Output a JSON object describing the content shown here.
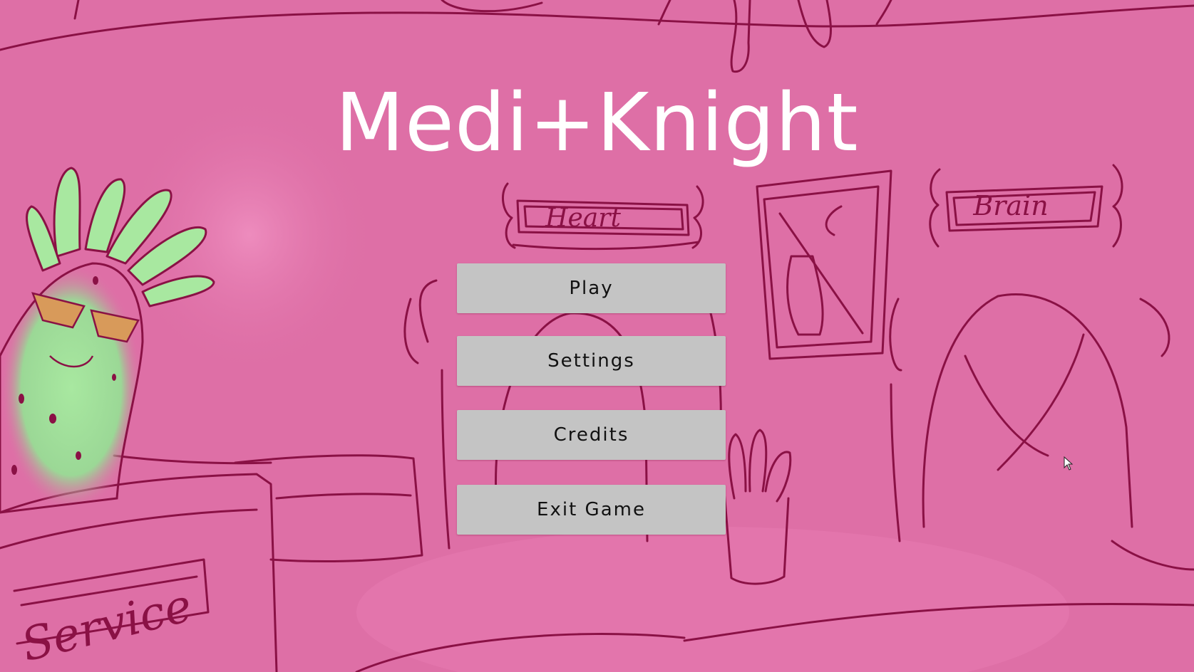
{
  "title": "Medi+Knight",
  "menu": {
    "play_label": "Play",
    "settings_label": "Settings",
    "credits_label": "Credits",
    "exit_label": "Exit Game"
  },
  "background": {
    "sign_heart": "Heart",
    "sign_brain": "Brain",
    "sign_service": "Service"
  },
  "colors": {
    "background": "#de6fa6",
    "ink": "#8a1145",
    "title": "#ffffff",
    "button_fill": "#c4c4c4",
    "button_text": "#111111",
    "germ_green": "#9fe09a"
  }
}
